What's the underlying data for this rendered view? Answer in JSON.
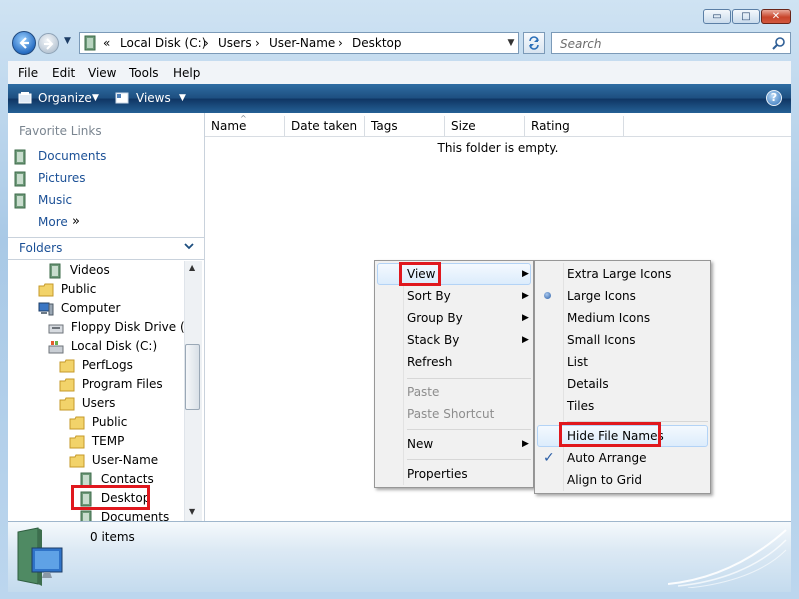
{
  "window": {
    "min_glyph": "▭",
    "max_glyph": "□",
    "close_glyph": "✕"
  },
  "address": {
    "prefix": "«",
    "crumbs": [
      "Local Disk (C:)",
      "Users",
      "User-Name",
      "Desktop"
    ],
    "sep": "›"
  },
  "search": {
    "placeholder": "Search"
  },
  "menubar": [
    "File",
    "Edit",
    "View",
    "Tools",
    "Help"
  ],
  "toolbar": {
    "organize": "Organize",
    "views": "Views",
    "help": "?"
  },
  "favorites": {
    "title": "Favorite Links",
    "items": [
      "Documents",
      "Pictures",
      "Music"
    ],
    "more": "More",
    "more_glyph": "»"
  },
  "folders": {
    "title": "Folders",
    "tree": [
      "Videos",
      "Public",
      "Computer",
      "Floppy Disk Drive (A:)",
      "Local Disk (C:)",
      "PerfLogs",
      "Program Files",
      "Users",
      "Public",
      "TEMP",
      "User-Name",
      "Contacts",
      "Desktop",
      "Documents"
    ]
  },
  "columns": [
    "Name",
    "Date taken",
    "Tags",
    "Size",
    "Rating"
  ],
  "empty_message": "This folder is empty.",
  "details": {
    "count": "0 items"
  },
  "context_menu": {
    "items": [
      "View",
      "Sort By",
      "Group By",
      "Stack By",
      "Refresh",
      "Paste",
      "Paste Shortcut",
      "New",
      "Properties"
    ],
    "submenu_glyph": "▶"
  },
  "view_submenu": {
    "items": [
      "Extra Large Icons",
      "Large Icons",
      "Medium Icons",
      "Small Icons",
      "List",
      "Details",
      "Tiles",
      "Hide File Names",
      "Auto Arrange",
      "Align to Grid"
    ],
    "check": "✓"
  },
  "colors": {
    "accent": "#1d4e7f",
    "link": "#1b5096",
    "highlight_border": "#e0181e"
  }
}
